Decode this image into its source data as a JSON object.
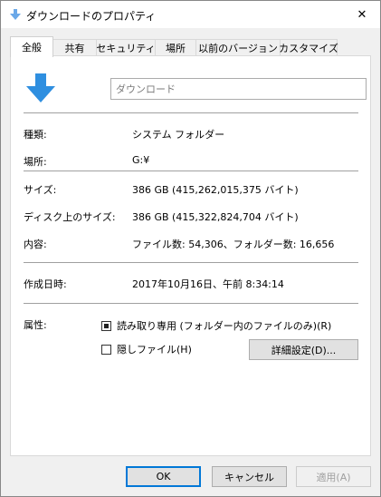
{
  "window": {
    "title": "ダウンロードのプロパティ",
    "close_glyph": "✕",
    "icon": "download-arrow-icon"
  },
  "tabs": [
    {
      "label": "全般",
      "active": true
    },
    {
      "label": "共有"
    },
    {
      "label": "セキュリティ"
    },
    {
      "label": "場所"
    },
    {
      "label": "以前のバージョン"
    },
    {
      "label": "カスタマイズ"
    }
  ],
  "general": {
    "folder_name": "ダウンロード",
    "type_label": "種類:",
    "type_value": "システム フォルダー",
    "location_label": "場所:",
    "location_value": "G:¥",
    "size_label": "サイズ:",
    "size_value": "386 GB (415,262,015,375 バイト)",
    "size_on_disk_label": "ディスク上のサイズ:",
    "size_on_disk_value": "386 GB (415,322,824,704 バイト)",
    "contents_label": "内容:",
    "contents_value": "ファイル数: 54,306、フォルダー数: 16,656",
    "created_label": "作成日時:",
    "created_value": "2017年10月16日、午前 8:34:14",
    "attributes_label": "属性:",
    "readonly_label": "読み取り専用 (フォルダー内のファイルのみ)(R)",
    "readonly_state": "indeterminate",
    "hidden_label": "隠しファイル(H)",
    "hidden_state": "unchecked",
    "advanced_button": "詳細設定(D)..."
  },
  "buttons": {
    "ok": "OK",
    "cancel": "キャンセル",
    "apply": "適用(A)"
  },
  "colors": {
    "accent": "#0078d7",
    "folder_arrow": "#2f8fe0",
    "disabled_text": "#a0a0a0"
  }
}
